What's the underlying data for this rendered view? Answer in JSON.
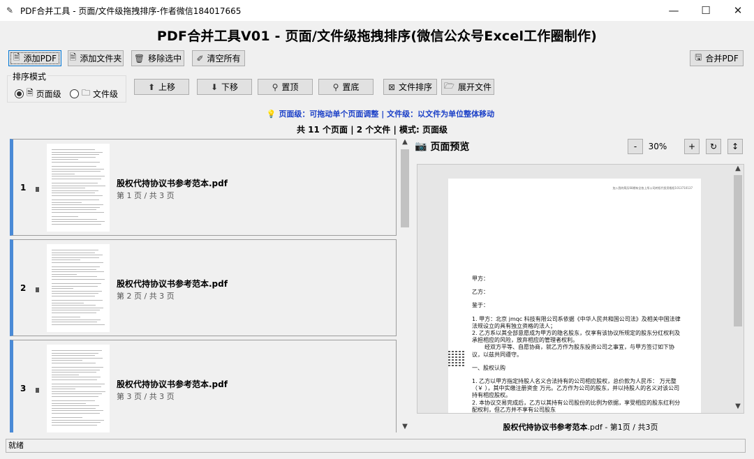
{
  "window": {
    "title": "PDF合并工具 - 页面/文件级拖拽排序-作者微信184017665",
    "app_icon": "feather-icon",
    "minimize": "—",
    "maximize": "☐",
    "close": "✕"
  },
  "heading": "PDF合并工具V01 - 页面/文件级拖拽排序(微信公众号Excel工作圈制作)",
  "toolbar": {
    "add_pdf": "添加PDF",
    "add_folder": "添加文件夹",
    "remove_selected": "移除选中",
    "clear_all": "清空所有",
    "merge_pdf": "合并PDF"
  },
  "sort_mode": {
    "legend": "排序模式",
    "page_level": "页面级",
    "file_level": "文件级",
    "selected": "page_level"
  },
  "actions": {
    "move_up": "上移",
    "move_down": "下移",
    "to_top": "置顶",
    "to_bottom": "置底",
    "sort_files": "文件排序",
    "expand_files": "展开文件"
  },
  "hint": "页面级：可拖动单个页面调整 | 文件级：以文件为单位整体移动",
  "stats": "共 11 个页面 | 2 个文件 | 模式: 页面级",
  "list": [
    {
      "index": "1",
      "filename": "股权代持协议书参考范本.pdf",
      "page_info": "第 1 页 / 共 3 页"
    },
    {
      "index": "2",
      "filename": "股权代持协议书参考范本.pdf",
      "page_info": "第 2 页 / 共 3 页"
    },
    {
      "index": "3",
      "filename": "股权代持协议书参考范本.pdf",
      "page_info": "第 3 页 / 共 3 页"
    }
  ],
  "preview": {
    "title": "页面预览",
    "zoom_minus": "-",
    "zoom": "30%",
    "zoom_plus": "+",
    "rotate": "↻",
    "fit": "↕",
    "page_header": "加入我的简历68期有全各上所公司转权代投资格权1013710137",
    "body": [
      "甲方：",
      "乙方：",
      "",
      "鉴于：",
      "1. 甲方：北京 jmqc 科技有限公司系依据《中华人民共和国公司法》及相关中国法律法规设立的具有独立资格的法人；",
      "2. 乙方系以其全部意愿成为甲方的隐名股东，仅享有该协议所规定的股东分红权利及承担相应的风险，放弃相应的管理者权利。",
      "经双方平等、自愿协商，就乙方作为股东投资公司之事宜，与甲方签订如下协议，以兹共同遵守。",
      "",
      "一、股权认购",
      "",
      "1. 乙方以甲方指定持股人名义合法持有的公司相应股权，总价款为人民币：   万元整（￥            ），其中实缴注册资金      万元。乙方作为公司的股东，并以持股人的名义对该公司持有相应股权。",
      "2. 本协议交易完成后，乙方以其持有公司股份的比例为依据，享受相应的股东红利分配权利，但乙方并不享有公司股东"
    ],
    "footer_name": "股权代持协议书参考范本",
    "footer_rest": ".pdf - 第1页 / 共3页"
  },
  "status": "就绪"
}
